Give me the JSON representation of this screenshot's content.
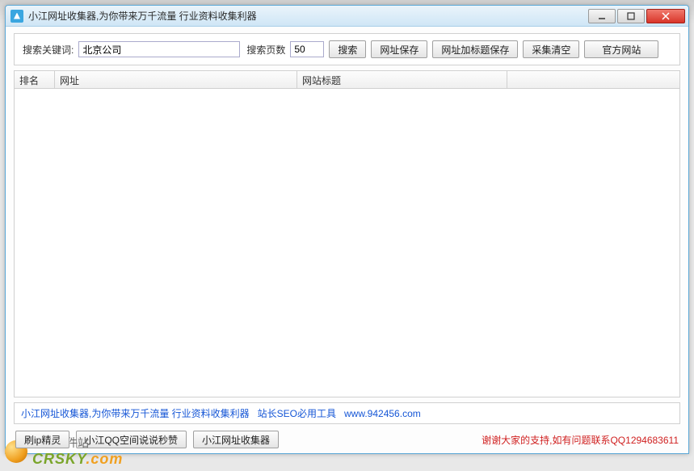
{
  "window": {
    "title": "小江网址收集器,为你带来万千流量 行业资料收集利器"
  },
  "search": {
    "keyword_label": "搜索关键词:",
    "keyword_value": "北京公司",
    "pages_label": "搜索页数",
    "pages_value": "50",
    "buttons": {
      "search": "搜索",
      "save_url": "网址保存",
      "save_url_title": "网址加标题保存",
      "clear": "采集清空",
      "official": "官方网站"
    }
  },
  "table": {
    "headers": {
      "rank": "排名",
      "url": "网址",
      "title": "网站标题"
    }
  },
  "footer": {
    "text1": "小江网址收集器,为你带来万千流量 行业资料收集利器",
    "text2": "站长SEO必用工具",
    "link": "www.942456.com"
  },
  "bottom": {
    "btn_ip": "刷ip精灵",
    "btn_qq": "小江QQ空间说说秒赞",
    "btn_collector": "小江网址收集器",
    "support": "谢谢大家的支持,如有问题联系QQ1294683611"
  },
  "watermark": {
    "cn": "非凡软件站",
    "en1": "CRSKY",
    "en2": ".com"
  }
}
